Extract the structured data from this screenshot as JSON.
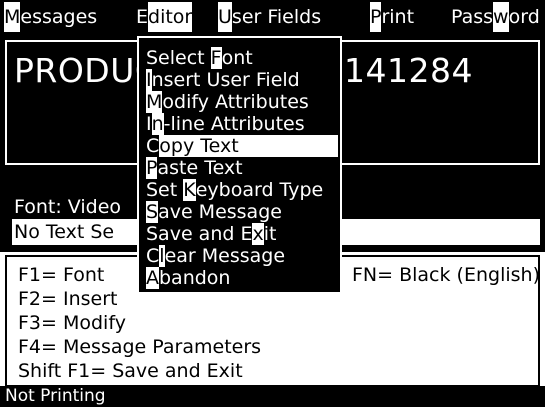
{
  "menu_bar": {
    "items": [
      {
        "pre": "",
        "key": "M",
        "post": "essages"
      },
      {
        "pre": "",
        "key": "E",
        "post": "ditor"
      },
      {
        "pre": "",
        "key": "U",
        "post": "ser Fields"
      },
      {
        "pre": "",
        "key": "P",
        "post": "rint"
      },
      {
        "pre": "Pass",
        "key": "w",
        "post": "ord"
      }
    ]
  },
  "editor": {
    "message_left": "PRODUC",
    "message_right": "141284",
    "font_line": "Font: Video",
    "status_row": "No Text Se"
  },
  "editor_menu": {
    "items": [
      {
        "pre": "Select ",
        "key": "F",
        "post": "ont"
      },
      {
        "pre": "",
        "key": "I",
        "post": "nsert User Field"
      },
      {
        "pre": "",
        "key": "M",
        "post": "odify Attributes"
      },
      {
        "pre": "I",
        "key": "n",
        "post": "-line Attributes"
      },
      {
        "pre": "",
        "key": "C",
        "post": "opy Text"
      },
      {
        "pre": "",
        "key": "P",
        "post": "aste Text"
      },
      {
        "pre": "Set ",
        "key": "K",
        "post": "eyboard Type"
      },
      {
        "pre": "",
        "key": "S",
        "post": "ave Message"
      },
      {
        "pre": "Save and E",
        "key": "x",
        "post": "it"
      },
      {
        "pre": "C",
        "key": "l",
        "post": "ear Message"
      },
      {
        "pre": "",
        "key": "A",
        "post": "bandon"
      }
    ]
  },
  "help": {
    "lines": [
      "F1= Font",
      "F2= Insert",
      "F3= Modify",
      "F4= Message Parameters",
      "Shift F1= Save and Exit"
    ],
    "fn_line": "FN= Black (English)"
  },
  "status_bar": "Not Printing"
}
